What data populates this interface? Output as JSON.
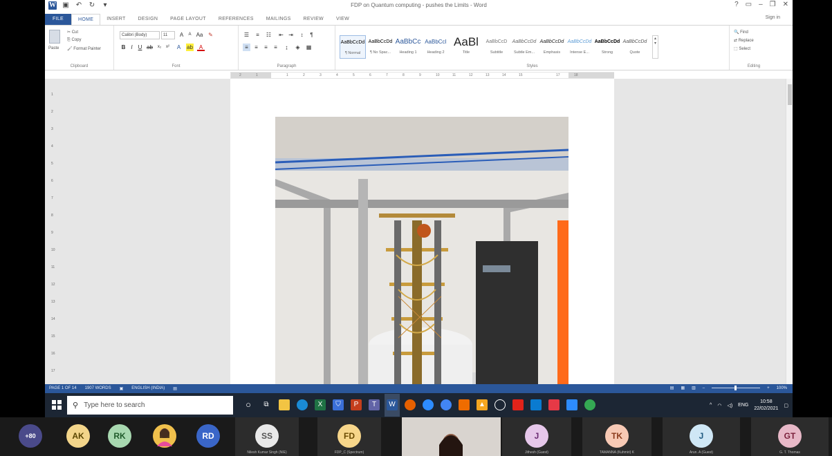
{
  "word": {
    "title": "FDP on Quantum computing - pushes the Limits - Word",
    "signin": "Sign in",
    "tabs": [
      "FILE",
      "HOME",
      "INSERT",
      "DESIGN",
      "PAGE LAYOUT",
      "REFERENCES",
      "MAILINGS",
      "REVIEW",
      "VIEW"
    ],
    "active_tab": "HOME",
    "ribbon": {
      "clipboard": {
        "paste": "Paste",
        "cut": "Cut",
        "copy": "Copy",
        "format_painter": "Format Painter",
        "label": "Clipboard"
      },
      "font": {
        "name": "Calibri (Body)",
        "size": "11",
        "label": "Font"
      },
      "paragraph": {
        "label": "Paragraph"
      },
      "styles": {
        "label": "Styles",
        "items": [
          {
            "sample": "AaBbCcDd",
            "name": "¶ Normal"
          },
          {
            "sample": "AaBbCcDd",
            "name": "¶ No Spac..."
          },
          {
            "sample": "AaBbCc",
            "name": "Heading 1"
          },
          {
            "sample": "AaBbCcI",
            "name": "Heading 2"
          },
          {
            "sample": "AaBl",
            "name": "Title"
          },
          {
            "sample": "AaBbCcD",
            "name": "Subtitle"
          },
          {
            "sample": "AaBbCcDd",
            "name": "Subtle Em..."
          },
          {
            "sample": "AaBbCcDd",
            "name": "Emphasis"
          },
          {
            "sample": "AaBbCcDd",
            "name": "Intense E..."
          },
          {
            "sample": "AaBbCcDd",
            "name": "Strong"
          },
          {
            "sample": "AaBbCcDd",
            "name": "Quote"
          }
        ]
      },
      "editing": {
        "find": "Find",
        "replace": "Replace",
        "select": "Select",
        "label": "Editing"
      }
    },
    "ruler_ticks": [
      "2",
      "1",
      "1",
      "2",
      "3",
      "4",
      "5",
      "6",
      "7",
      "8",
      "9",
      "10",
      "11",
      "12",
      "13",
      "14",
      "15",
      "17",
      "18"
    ],
    "vruler_ticks": [
      "1",
      "2",
      "3",
      "4",
      "5",
      "6",
      "7",
      "8",
      "9",
      "10",
      "11",
      "12",
      "13",
      "14",
      "15",
      "16",
      "17"
    ],
    "status": {
      "page": "PAGE 1 OF 14",
      "words": "1907 WORDS",
      "language": "ENGLISH (INDIA)",
      "zoom": "100%"
    }
  },
  "taskbar": {
    "search_placeholder": "Type here to search",
    "tray": {
      "lang": "ENG",
      "time": "10:58",
      "date": "22/02/2021"
    }
  },
  "participants": {
    "overflow": "+80",
    "items": [
      {
        "initials": "AK",
        "color": "#f3d58a",
        "name": ""
      },
      {
        "initials": "RK",
        "color": "#a8d8b0",
        "name": ""
      },
      {
        "initials": "",
        "color": "#f0c04c",
        "name": ""
      },
      {
        "initials": "RD",
        "color": "#3a66c8",
        "name": ""
      },
      {
        "initials": "SS",
        "color": "#e9e9e9",
        "name": "Nilesh Kumar Singh (NIE)"
      },
      {
        "initials": "FD",
        "color": "#f7d68a",
        "name": "FDP_C (Spectrum)"
      },
      {
        "initials": "",
        "color": "",
        "name": ""
      },
      {
        "initials": "J",
        "color": "#e6c7ea",
        "name": "Jithesh (Guest)"
      },
      {
        "initials": "TK",
        "color": "#f7c9b4",
        "name": "TAMANNA (Kuhmiri) K"
      },
      {
        "initials": "J",
        "color": "#cfe7f5",
        "name": "Arun. A (Guest)"
      },
      {
        "initials": "GT",
        "color": "#e7b8c7",
        "name": "G. T. Thomas"
      }
    ]
  }
}
